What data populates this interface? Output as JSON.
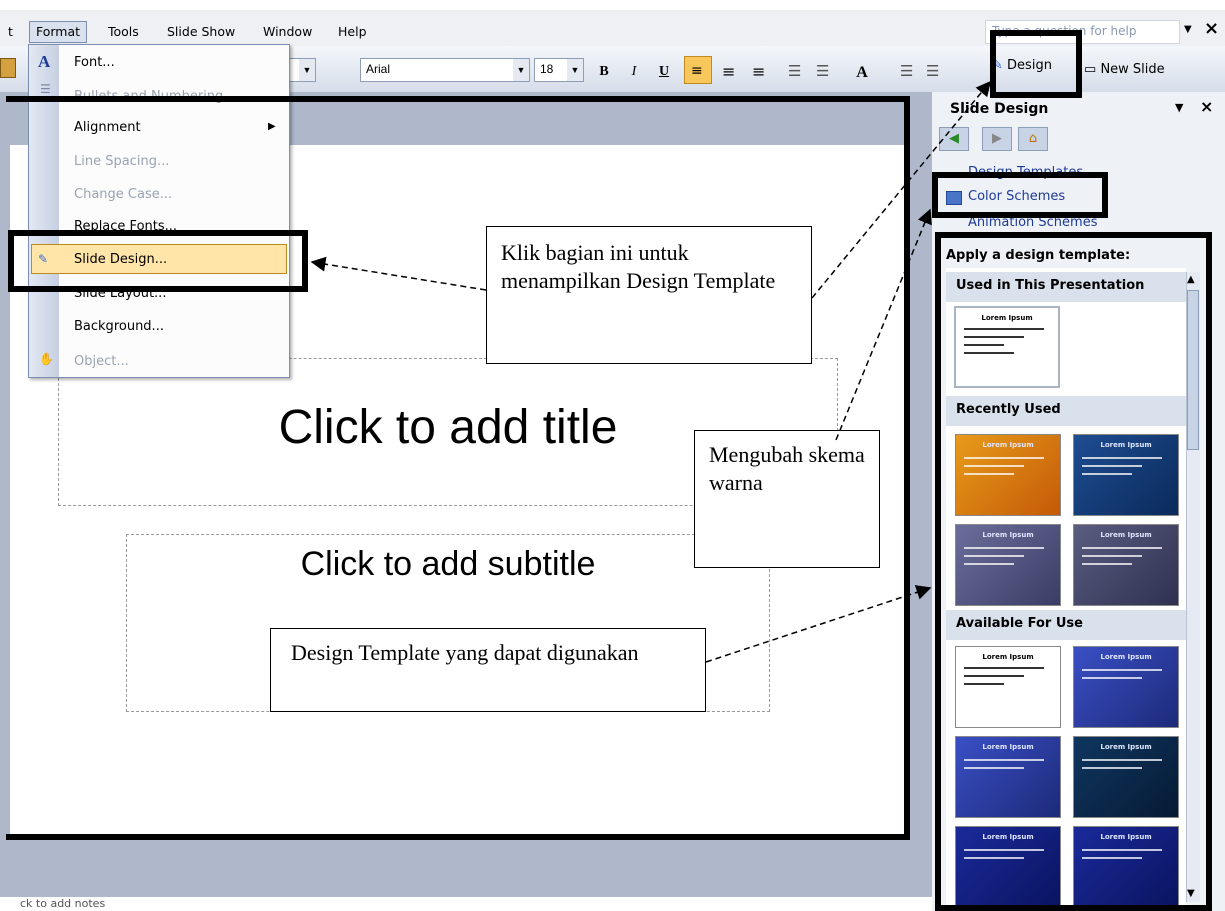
{
  "menubar": {
    "partial_item": "t",
    "items": [
      "Format",
      "Tools",
      "Slide Show",
      "Window",
      "Help"
    ],
    "help_placeholder": "Type a question for help",
    "close_glyph": "×"
  },
  "toolbar": {
    "font_name": "Arial",
    "font_size": "18",
    "bold": "B",
    "italic": "I",
    "underline": "U",
    "grow_font": "A",
    "design_label": "Design",
    "new_slide_label": "New Slide"
  },
  "format_menu": {
    "items": [
      {
        "label": "Font...",
        "disabled": false
      },
      {
        "label": "Bullets and Numbering...",
        "disabled": true
      },
      {
        "label": "Alignment",
        "disabled": false
      },
      {
        "label": "Line Spacing...",
        "disabled": true
      },
      {
        "label": "Change Case...",
        "disabled": true
      },
      {
        "label": "Replace Fonts...",
        "disabled": false
      },
      {
        "label": "Slide Design...",
        "disabled": false,
        "highlighted": true
      },
      {
        "label": "Slide Layout...",
        "disabled": false
      },
      {
        "label": "Background...",
        "disabled": false
      },
      {
        "label": "Object...",
        "disabled": true
      }
    ]
  },
  "slide": {
    "title_placeholder": "Click to add title",
    "subtitle_placeholder": "Click to add subtitle"
  },
  "taskpane": {
    "title": "Slide Design",
    "links": [
      "Design Templates",
      "Color Schemes",
      "Animation Schemes"
    ],
    "apply_heading": "Apply a design template:",
    "sections": [
      "Used in This Presentation",
      "Recently Used",
      "Available For Use"
    ],
    "thumb_title": "Lorem Ipsum"
  },
  "annotations": {
    "note1": "Klik bagian ini untuk menampilkan Design Template",
    "note2": "Mengubah skema warna",
    "note3": "Design Template yang dapat digunakan"
  },
  "statusbar": {
    "text": "ck to add notes"
  }
}
